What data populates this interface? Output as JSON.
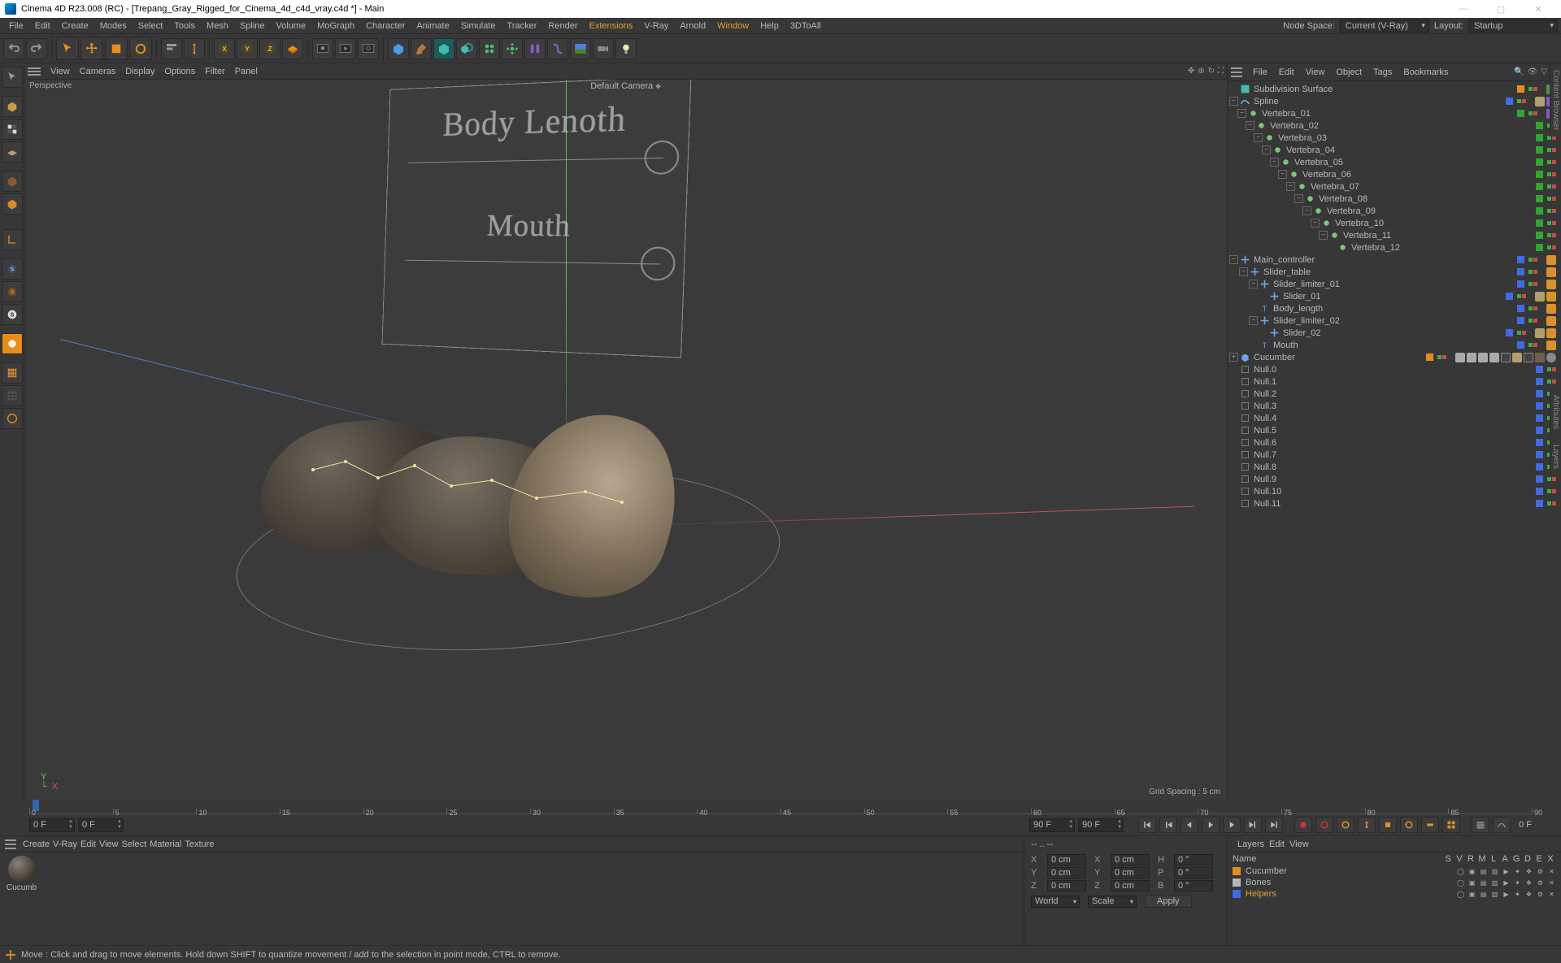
{
  "title": "Cinema 4D R23.008 (RC) - [Trepang_Gray_Rigged_for_Cinema_4d_c4d_vray.c4d *] - Main",
  "win": {
    "min": "—",
    "max": "▢",
    "close": "✕"
  },
  "nodespace": {
    "label": "Node Space:",
    "value": "Current (V-Ray)"
  },
  "layout": {
    "label": "Layout:",
    "value": "Startup"
  },
  "menu": [
    "File",
    "Edit",
    "Create",
    "Modes",
    "Select",
    "Tools",
    "Mesh",
    "Spline",
    "Volume",
    "MoGraph",
    "Character",
    "Animate",
    "Simulate",
    "Tracker",
    "Render",
    "Extensions",
    "V-Ray",
    "Arnold",
    "Window",
    "Help",
    "3DToAll"
  ],
  "vpmenu": [
    "View",
    "Cameras",
    "Display",
    "Options",
    "Filter",
    "Panel"
  ],
  "viewport": {
    "label": "Perspective",
    "camera": "Default Camera",
    "gridspacing": "Grid Spacing : 5 cm",
    "panel_label1": "Body Lenoth",
    "panel_label2": "Mouth",
    "axis_y": "Y",
    "axis_x": "X"
  },
  "ommenu": [
    "File",
    "Edit",
    "View",
    "Object",
    "Tags",
    "Bookmarks"
  ],
  "objects": {
    "subdiv": "Subdivision Surface",
    "spline": "Spline",
    "v01": "Vertebra_01",
    "v02": "Vertebra_02",
    "v03": "Vertebra_03",
    "v04": "Vertebra_04",
    "v05": "Vertebra_05",
    "v06": "Vertebra_06",
    "v07": "Vertebra_07",
    "v08": "Vertebra_08",
    "v09": "Vertebra_09",
    "v10": "Vertebra_10",
    "v11": "Vertebra_11",
    "v12": "Vertebra_12",
    "mainctrl": "Main_controller",
    "slidertable": "Slider_table",
    "slim1": "Slider_limiter_01",
    "slider1": "Slider_01",
    "bodylen": "Body_length",
    "slim2": "Slider_limiter_02",
    "slider2": "Slider_02",
    "mouth": "Mouth",
    "cucumber": "Cucumber",
    "n0": "Null.0",
    "n1": "Null.1",
    "n2": "Null.2",
    "n3": "Null.3",
    "n4": "Null.4",
    "n5": "Null.5",
    "n6": "Null.6",
    "n7": "Null.7",
    "n8": "Null.8",
    "n9": "Null.9",
    "n10": "Null.10",
    "n11": "Null.11"
  },
  "timeline": {
    "start1": "0 F",
    "start2": "0 F",
    "end1": "90 F",
    "end2": "90 F",
    "cur": "0 F",
    "ticks": [
      "0",
      "5",
      "10",
      "15",
      "20",
      "25",
      "30",
      "35",
      "40",
      "45",
      "50",
      "55",
      "60",
      "65",
      "70",
      "75",
      "80",
      "85",
      "90"
    ]
  },
  "matmenu": [
    "Create",
    "V-Ray",
    "Edit",
    "View",
    "Select",
    "Material",
    "Texture"
  ],
  "material": {
    "name": "Cucumb"
  },
  "coord": {
    "X": "X",
    "Y": "Y",
    "Z": "Z",
    "H": "H",
    "P": "P",
    "B": "B",
    "val": "0 cm",
    "deg": "0 °",
    "world": "World",
    "scale": "Scale",
    "apply": "Apply",
    "dash": "--",
    "dashdot": ".."
  },
  "layersmenu": [
    "Layers",
    "Edit",
    "View"
  ],
  "layerhdr": [
    "Name",
    "S",
    "V",
    "R",
    "M",
    "L",
    "A",
    "G",
    "D",
    "E",
    "X"
  ],
  "layers": {
    "l1": {
      "name": "Cucumber",
      "color": "#e88c1a"
    },
    "l2": {
      "name": "Bones",
      "color": "#b8b8b8"
    },
    "l3": {
      "name": "Helpers",
      "color": "#3f6ae8"
    }
  },
  "status": "Move : Click and drag to move elements. Hold down SHIFT to quantize movement / add to the selection in point mode, CTRL to remove.",
  "rightTabs": [
    "Content Browser",
    "Attributes",
    "Layers"
  ]
}
